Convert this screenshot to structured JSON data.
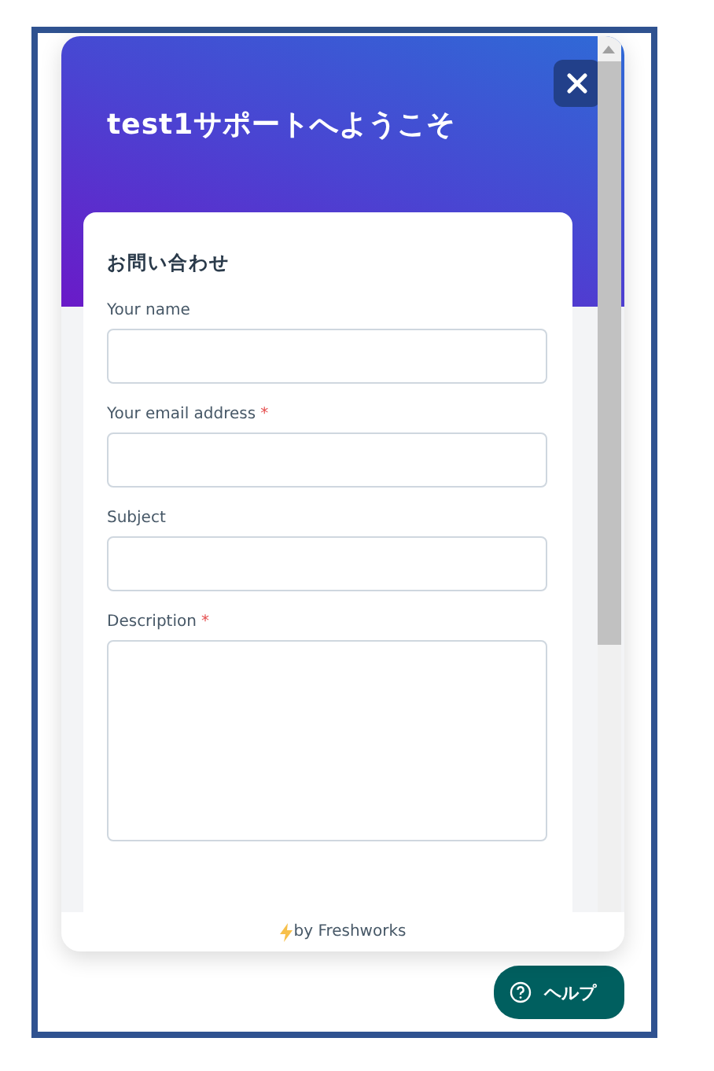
{
  "header": {
    "title": "test1サポートへようこそ"
  },
  "form": {
    "heading": "お問い合わせ",
    "fields": [
      {
        "label": "Your name",
        "kind": "text"
      },
      {
        "label": "Your email address",
        "required_marker": "*",
        "kind": "text"
      },
      {
        "label": "Subject",
        "kind": "text"
      },
      {
        "label": "Description",
        "required_marker": "*",
        "kind": "textarea"
      }
    ]
  },
  "footer": {
    "text": "by Freshworks"
  },
  "help_button": {
    "label": "ヘルプ"
  }
}
